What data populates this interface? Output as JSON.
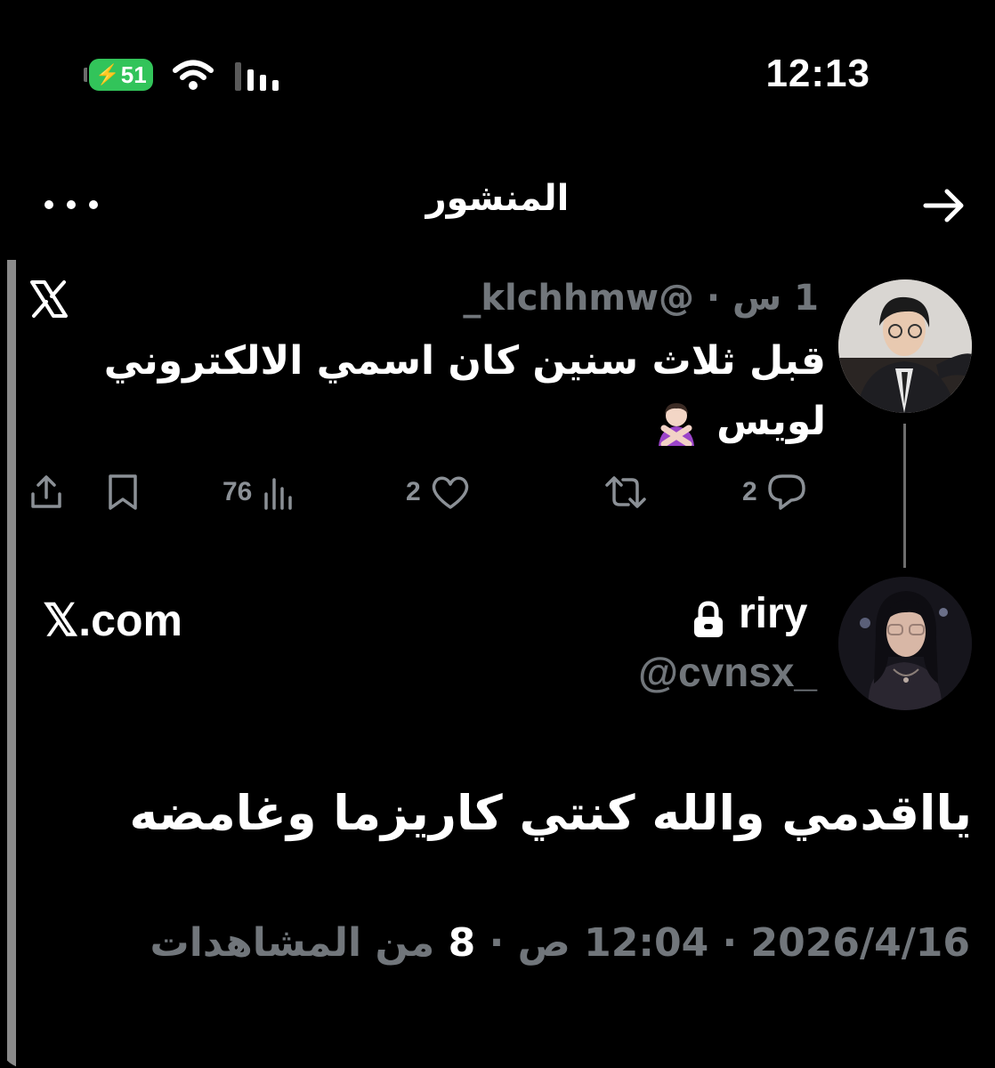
{
  "status_bar": {
    "battery_level": "51",
    "time": "12:13"
  },
  "header": {
    "title": "المنشور"
  },
  "quoted_tweet": {
    "meta": "1 س · @klchhmw_",
    "text": "قبل ثلاث سنين كان اسمي الالكتروني لويس",
    "actions": {
      "replies": "2",
      "reposts": "",
      "likes": "2",
      "views": "76"
    }
  },
  "main_tweet": {
    "source_label": "𝕏.com",
    "display_name": "riry",
    "handle": "@cvnsx_",
    "text": "يااقدمي والله كنتي كاريزما وغامضه",
    "date": "2026/4/16",
    "time": "12:04 ص",
    "views_count": "8",
    "views_label": "من المشاهدات"
  },
  "colors": {
    "background": "#000000",
    "muted_text": "#71767b",
    "battery_green": "#32c45a"
  }
}
